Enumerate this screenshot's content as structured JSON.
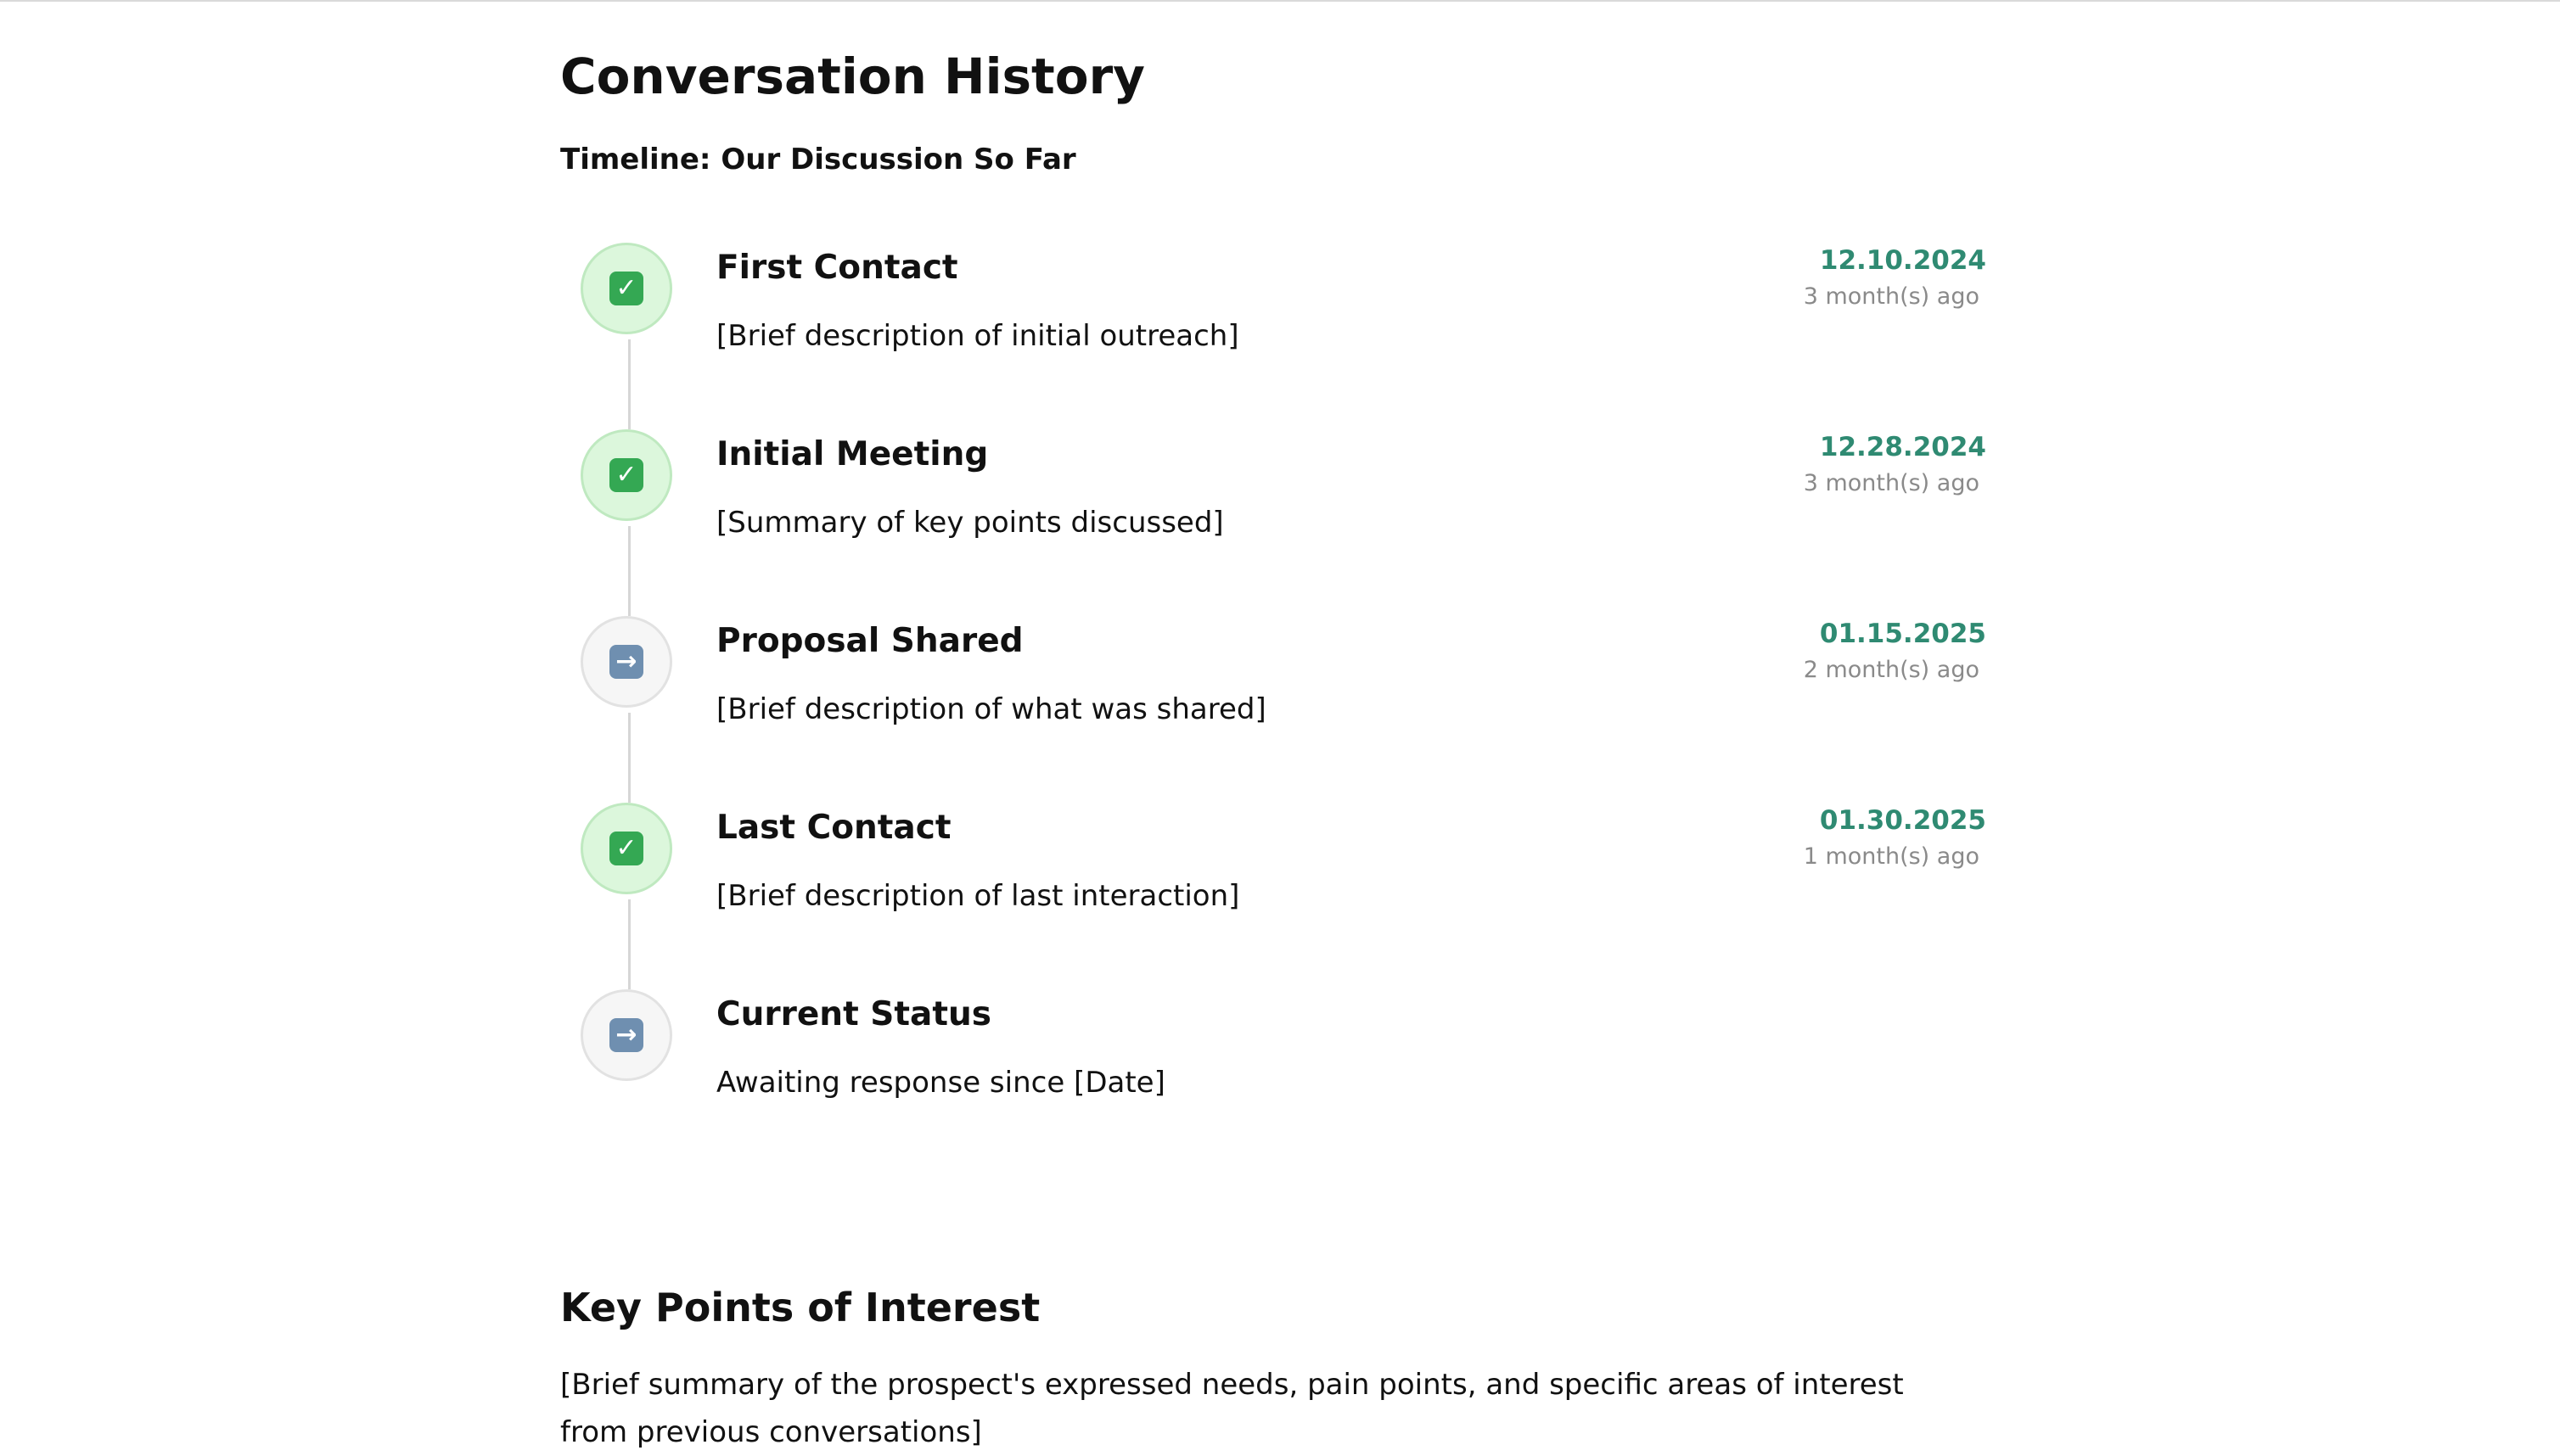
{
  "page": {
    "title": "Conversation History",
    "subtitle": "Timeline: Our Discussion So Far"
  },
  "timeline": [
    {
      "title": "First Contact",
      "description": "[Brief description of initial outreach]",
      "date": "12.10.2024",
      "ago": "3 month(s) ago",
      "status": "done",
      "icon": "check-mark-icon"
    },
    {
      "title": "Initial Meeting",
      "description": "[Summary of key points discussed]",
      "date": "12.28.2024",
      "ago": "3 month(s) ago",
      "status": "done",
      "icon": "check-mark-icon"
    },
    {
      "title": "Proposal Shared",
      "description": "[Brief description of what was shared]",
      "date": "01.15.2025",
      "ago": "2 month(s) ago",
      "status": "pending",
      "icon": "right-arrow-icon"
    },
    {
      "title": "Last Contact",
      "description": "[Brief description of last interaction]",
      "date": "01.30.2025",
      "ago": "1 month(s) ago",
      "status": "done",
      "icon": "check-mark-icon"
    },
    {
      "title": "Current Status",
      "description": "Awaiting response since [Date]",
      "date": "",
      "ago": "",
      "status": "pending",
      "icon": "right-arrow-icon"
    }
  ],
  "key_points": {
    "title": "Key Points of Interest",
    "body": "[Brief summary of the prospect's expressed needs, pain points, and specific areas of interest from previous conversations]"
  },
  "colors": {
    "date_accent": "#2f8a72",
    "done_circle": "#dcf7dc",
    "pending_circle": "#f6f6f6",
    "check_badge": "#34a853",
    "arrow_badge": "#6f8fb0"
  }
}
